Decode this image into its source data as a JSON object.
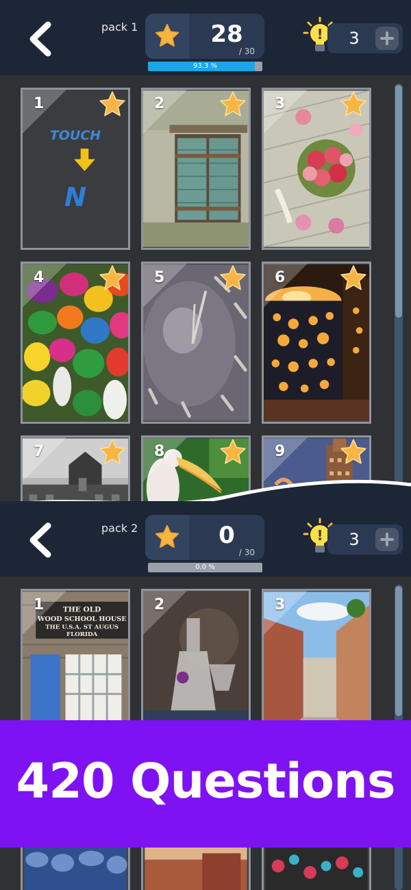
{
  "packs": [
    {
      "pack_label": "pack 1",
      "stars_earned": "28",
      "stars_total": "/ 30",
      "progress_text": "93.3 %",
      "progress_fraction": 0.933,
      "hints": "3",
      "tiles": [
        {
          "number": "1",
          "text": "TOUCH",
          "art": "tutorial"
        },
        {
          "number": "2",
          "art": "window-shutters"
        },
        {
          "number": "3",
          "art": "rose-bouquet"
        },
        {
          "number": "4",
          "art": "candies"
        },
        {
          "number": "5",
          "art": "clock-face"
        },
        {
          "number": "6",
          "art": "candle-lantern"
        },
        {
          "number": "7",
          "art": "old-building"
        },
        {
          "number": "8",
          "art": "pelican"
        },
        {
          "number": "9",
          "art": "skyscraper"
        }
      ]
    },
    {
      "pack_label": "pack 2",
      "stars_earned": "0",
      "stars_total": "/ 30",
      "progress_text": "0.0 %",
      "progress_fraction": 0.0,
      "hints": "3",
      "tiles": [
        {
          "number": "1",
          "art": "wood-school-house",
          "sign_lines": [
            "THE OLD",
            "WOOD SCHOOL HOUSE",
            "THE U.S.A. ST AUGUS",
            "FLORIDA"
          ]
        },
        {
          "number": "2",
          "art": "glass-decanter"
        },
        {
          "number": "3",
          "art": "street-scene"
        }
      ]
    }
  ],
  "banner": {
    "text": "420 Questions"
  },
  "colors": {
    "header": "#1d2636",
    "accent_progress": "#1aa6ea",
    "banner": "#7f12f3",
    "star": "#f7b543"
  },
  "icons": {
    "back": "chevron-left-icon",
    "star": "star-icon",
    "hint": "lightbulb-icon",
    "add": "plus-icon"
  }
}
